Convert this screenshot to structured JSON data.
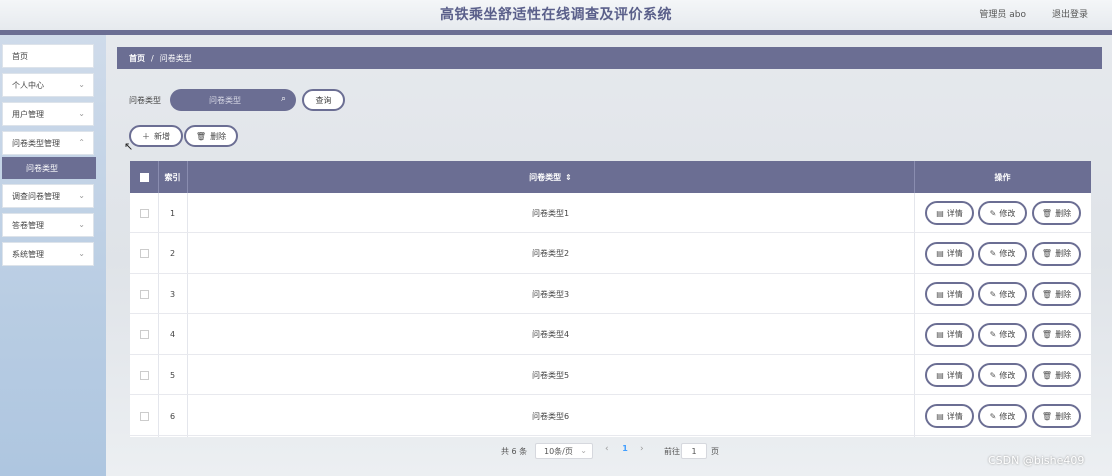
{
  "header": {
    "title": "高铁乘坐舒适性在线调查及评价系统",
    "user": "管理员 abo",
    "logout": "退出登录"
  },
  "sidebar": {
    "items": [
      {
        "label": "首页",
        "has_arrow": false
      },
      {
        "label": "个人中心",
        "has_arrow": true
      },
      {
        "label": "用户管理",
        "has_arrow": true
      },
      {
        "label": "问卷类型管理",
        "has_arrow": true,
        "expanded": true
      },
      {
        "label": "调查问卷管理",
        "has_arrow": true
      },
      {
        "label": "答卷管理",
        "has_arrow": true
      },
      {
        "label": "系统管理",
        "has_arrow": true
      }
    ],
    "active_sub": "问卷类型"
  },
  "breadcrumb": {
    "home": "首页",
    "separator": "/",
    "current": "问卷类型"
  },
  "search": {
    "label": "问卷类型",
    "placeholder": "问卷类型",
    "button": "查询"
  },
  "actions": {
    "add": "新增",
    "delete": "删除"
  },
  "table": {
    "columns": {
      "index": "索引",
      "type": "问卷类型",
      "ops": "操作"
    },
    "sort_indicator": "⇕",
    "rows": [
      {
        "index": "1",
        "type": "问卷类型1"
      },
      {
        "index": "2",
        "type": "问卷类型2"
      },
      {
        "index": "3",
        "type": "问卷类型3"
      },
      {
        "index": "4",
        "type": "问卷类型4"
      },
      {
        "index": "5",
        "type": "问卷类型5"
      },
      {
        "index": "6",
        "type": "问卷类型6"
      }
    ],
    "row_actions": {
      "detail": "详情",
      "edit": "修改",
      "delete": "删除"
    }
  },
  "pagination": {
    "total": "共 6 条",
    "page_size": "10条/页",
    "current_page": "1",
    "goto_label": "前往",
    "goto_value": "1",
    "page_suffix": "页",
    "active_color": "#409eff"
  },
  "watermark": "CSDN @bishe409",
  "theme": {
    "primary": "#6b6e93",
    "header_title": "#5a5f8a"
  }
}
